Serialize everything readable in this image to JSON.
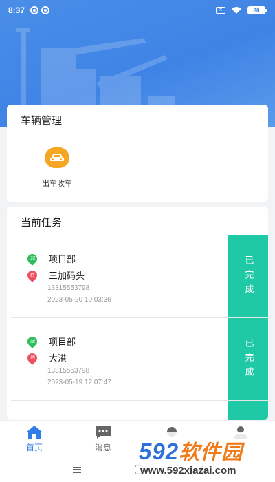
{
  "status_bar": {
    "time": "8:37",
    "battery": "88"
  },
  "vehicle_card": {
    "title": "车辆管理",
    "items": [
      {
        "label": "出车收车",
        "icon": "car-icon",
        "color": "#f5a623"
      }
    ]
  },
  "tasks_card": {
    "title": "当前任务",
    "tasks": [
      {
        "start_badge": "起",
        "start": "项目部",
        "end_badge": "终",
        "end": "三加码头",
        "phone": "13315553798",
        "datetime": "2023-05-20 10:03:36",
        "status": "已完成"
      },
      {
        "start_badge": "起",
        "start": "项目部",
        "end_badge": "终",
        "end": "大港",
        "phone": "13315553798",
        "datetime": "2023-05-19 12:07:47",
        "status": "已完成"
      }
    ],
    "status_color": "#1fc9a6"
  },
  "tabbar": {
    "tabs": [
      {
        "label": "首页",
        "icon": "home-icon",
        "active": true
      },
      {
        "label": "消息",
        "icon": "message-icon",
        "active": false
      },
      {
        "label": "",
        "icon": "task-icon",
        "active": false
      },
      {
        "label": "",
        "icon": "user-icon",
        "active": false
      }
    ],
    "accent": "#2f7ee8"
  },
  "watermark": {
    "logo_num": "592",
    "logo_cn": "软件园",
    "url": "www.592xiazai.com"
  }
}
